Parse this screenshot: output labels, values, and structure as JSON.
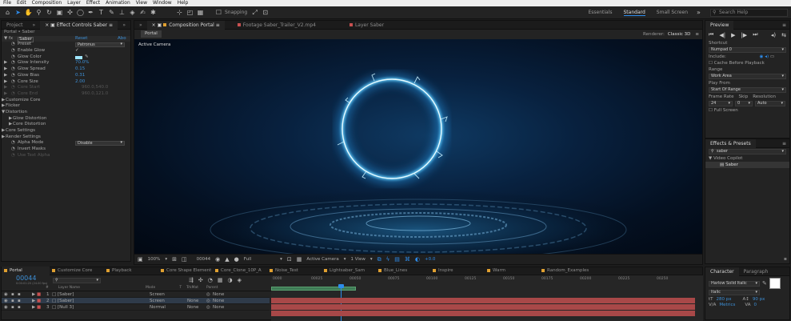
{
  "menu": [
    "File",
    "Edit",
    "Composition",
    "Layer",
    "Effect",
    "Animation",
    "View",
    "Window",
    "Help"
  ],
  "toolbar": {
    "snapping_label": "Snapping",
    "workspaces": [
      "Essentials",
      "Standard",
      "Small Screen"
    ],
    "active_workspace": "Standard",
    "search_placeholder": "Search Help"
  },
  "effect_controls": {
    "tabs": [
      "Project",
      "Effect Controls Saber"
    ],
    "breadcrumb": "Portal • Saber",
    "effect_name": "Saber",
    "reset_label": "Reset",
    "about_label": "Abo",
    "params": [
      {
        "label": "Preset",
        "value": "Patronus",
        "type": "dropdown"
      },
      {
        "label": "Enable Glow",
        "value": "✓",
        "type": "check"
      },
      {
        "label": "Glow Color",
        "value": "",
        "type": "color"
      },
      {
        "label": "Glow Intensity",
        "value": "70.0%",
        "type": "value"
      },
      {
        "label": "Glow Spread",
        "value": "0.15",
        "type": "value"
      },
      {
        "label": "Glow Bias",
        "value": "0.31",
        "type": "value"
      },
      {
        "label": "Core Size",
        "value": "2.00",
        "type": "value"
      },
      {
        "label": "Core Start",
        "value": "960.0,540.0",
        "type": "dim"
      },
      {
        "label": "Core End",
        "value": "960.0,121.0",
        "type": "dim"
      },
      {
        "label": "Customize Core",
        "value": "",
        "type": "group"
      },
      {
        "label": "Flicker",
        "value": "",
        "type": "group"
      },
      {
        "label": "Distortion",
        "value": "",
        "type": "group"
      },
      {
        "label": "Glow Distortion",
        "value": "",
        "type": "subgroup"
      },
      {
        "label": "Core Distortion",
        "value": "",
        "type": "subgroup"
      },
      {
        "label": "Core Settings",
        "value": "",
        "type": "group"
      },
      {
        "label": "Render Settings",
        "value": "",
        "type": "group"
      },
      {
        "label": "Alpha Mode",
        "value": "Disable",
        "type": "dropdown"
      },
      {
        "label": "Invert Masks",
        "value": "",
        "type": "check"
      },
      {
        "label": "Use Text Alpha",
        "value": "",
        "type": "dimcheck"
      }
    ]
  },
  "composition": {
    "tabs": [
      "Composition Portal",
      "Footage Saber_Trailer_V2.mp4",
      "Layer Saber"
    ],
    "sub_tab": "Portal",
    "renderer_label": "Renderer:",
    "renderer": "Classic 3D",
    "view_label": "Active Camera",
    "viewer_bar": {
      "zoom": "100%",
      "timecode": "00044",
      "resolution": "Full",
      "camera": "Active Camera",
      "views": "1 View",
      "exposure": "+0.0"
    }
  },
  "preview": {
    "title": "Preview",
    "shortcut_label": "Shortcut",
    "shortcut_value": "Numpad 0",
    "include_label": "Include:",
    "cache_label": "Cache Before Playback",
    "range_label": "Range",
    "range_value": "Work Area",
    "play_from_label": "Play From",
    "play_from_value": "Start Of Range",
    "frame_rate_label": "Frame Rate",
    "skip_label": "Skip",
    "resolution_label": "Resolution",
    "frame_rate": "24",
    "skip": "0",
    "resolution": "Auto",
    "full_screen_label": "Full Screen"
  },
  "effects_presets": {
    "title": "Effects & Presets",
    "search_value": "saber",
    "category": "Video Copilot",
    "item": "Saber"
  },
  "character": {
    "tabs": [
      "Character",
      "Paragraph"
    ],
    "font": "Harlow Solid Italic",
    "style": "Italic",
    "size": "280 px",
    "leading": "90 px",
    "kerning": "Metrics",
    "tracking": "0"
  },
  "timeline": {
    "tabs": [
      "Portal",
      "Customize Core",
      "Playback",
      "Core Shape Element 3D",
      "Core_Clone_10P_A",
      "Noise_Test",
      "Lightsaber_Sam",
      "Blue_Lines",
      "Inspire",
      "Warm",
      "Random_Examples"
    ],
    "timecode": "00044",
    "timecode_sub": "0:00:01:20 (24.00 fps)",
    "search_placeholder": "",
    "columns": [
      "#",
      "Layer Name",
      "Mode",
      "T",
      "TrkMat",
      "Parent"
    ],
    "ruler_ticks": [
      "0000",
      "00025",
      "00050",
      "00075",
      "00100",
      "00125",
      "00150",
      "00175",
      "00200",
      "00225",
      "00250"
    ],
    "layers": [
      {
        "num": "1",
        "name": "[Saber]",
        "mode": "Screen",
        "trkmat": "",
        "parent": "None"
      },
      {
        "num": "2",
        "name": "[Saber]",
        "mode": "Screen",
        "trkmat": "None",
        "parent": "None"
      },
      {
        "num": "3",
        "name": "[Null 3]",
        "mode": "Normal",
        "trkmat": "None",
        "parent": "None"
      }
    ]
  },
  "colors": {
    "accent_blue": "#2d8ceb",
    "glow_cyan": "#9fe6ff",
    "layer_bar_red": "#a84848",
    "work_area_green": "#3e7a55"
  }
}
